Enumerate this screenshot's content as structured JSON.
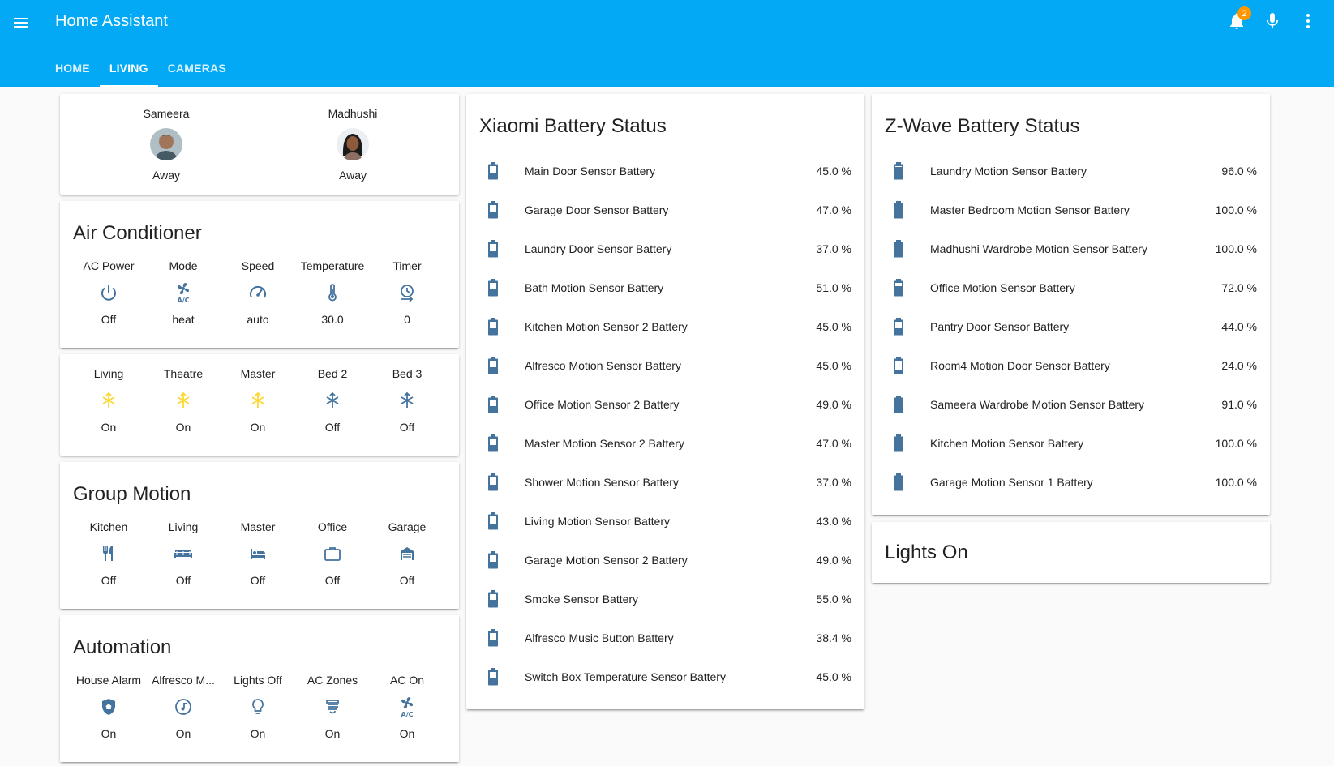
{
  "app": {
    "title": "Home Assistant",
    "notification_count": "2"
  },
  "tabs": [
    {
      "label": "HOME"
    },
    {
      "label": "LIVING"
    },
    {
      "label": "CAMERAS"
    }
  ],
  "people": [
    {
      "name": "Sameera",
      "state": "Away"
    },
    {
      "name": "Madhushi",
      "state": "Away"
    }
  ],
  "air_conditioner": {
    "title": "Air Conditioner",
    "items": [
      {
        "label": "AC Power",
        "icon": "power-icon",
        "state": "Off"
      },
      {
        "label": "Mode",
        "icon": "air-conditioner-icon",
        "state": "heat"
      },
      {
        "label": "Speed",
        "icon": "speedometer-icon",
        "state": "auto"
      },
      {
        "label": "Temperature",
        "icon": "thermometer-icon",
        "state": "30.0"
      },
      {
        "label": "Timer",
        "icon": "timer-icon",
        "state": "0"
      }
    ]
  },
  "ac_zones": {
    "items": [
      {
        "label": "Living",
        "icon": "air-zone-icon",
        "state": "On",
        "color": "#fdd835"
      },
      {
        "label": "Theatre",
        "icon": "air-zone-icon",
        "state": "On",
        "color": "#fdd835"
      },
      {
        "label": "Master",
        "icon": "air-zone-icon",
        "state": "On",
        "color": "#fdd835"
      },
      {
        "label": "Bed 2",
        "icon": "air-zone-icon",
        "state": "Off",
        "color": "#44739e"
      },
      {
        "label": "Bed 3",
        "icon": "air-zone-icon",
        "state": "Off",
        "color": "#44739e"
      }
    ]
  },
  "group_motion": {
    "title": "Group Motion",
    "items": [
      {
        "label": "Kitchen",
        "icon": "silverware-icon",
        "state": "Off"
      },
      {
        "label": "Living",
        "icon": "sofa-icon",
        "state": "Off"
      },
      {
        "label": "Master",
        "icon": "bed-icon",
        "state": "Off"
      },
      {
        "label": "Office",
        "icon": "briefcase-icon",
        "state": "Off"
      },
      {
        "label": "Garage",
        "icon": "garage-icon",
        "state": "Off"
      }
    ]
  },
  "automation": {
    "title": "Automation",
    "items": [
      {
        "label": "House Alarm",
        "icon": "shield-home-icon",
        "state": "On"
      },
      {
        "label": "Alfresco M...",
        "icon": "music-icon",
        "state": "On"
      },
      {
        "label": "Lights Off",
        "icon": "lightbulb-icon",
        "state": "On"
      },
      {
        "label": "AC Zones",
        "icon": "air-vent-icon",
        "state": "On"
      },
      {
        "label": "AC On",
        "icon": "air-conditioner-icon",
        "state": "On"
      }
    ]
  },
  "xiaomi": {
    "title": "Xiaomi Battery Status",
    "rows": [
      {
        "name": "Main Door Sensor Battery",
        "state": "45.0 %",
        "level": 45
      },
      {
        "name": "Garage Door Sensor Battery",
        "state": "47.0 %",
        "level": 47
      },
      {
        "name": "Laundry Door Sensor Battery",
        "state": "37.0 %",
        "level": 37
      },
      {
        "name": "Bath Motion Sensor Battery",
        "state": "51.0 %",
        "level": 51
      },
      {
        "name": "Kitchen Motion Sensor 2 Battery",
        "state": "45.0 %",
        "level": 45
      },
      {
        "name": "Alfresco Motion Sensor Battery",
        "state": "45.0 %",
        "level": 45
      },
      {
        "name": "Office Motion Sensor 2 Battery",
        "state": "49.0 %",
        "level": 49
      },
      {
        "name": "Master Motion Sensor 2 Battery",
        "state": "47.0 %",
        "level": 47
      },
      {
        "name": "Shower Motion Sensor Battery",
        "state": "37.0 %",
        "level": 37
      },
      {
        "name": "Living Motion Sensor Battery",
        "state": "43.0 %",
        "level": 43
      },
      {
        "name": "Garage Motion Sensor 2 Battery",
        "state": "49.0 %",
        "level": 49
      },
      {
        "name": "Smoke Sensor Battery",
        "state": "55.0 %",
        "level": 55
      },
      {
        "name": "Alfresco Music Button Battery",
        "state": "38.4 %",
        "level": 38
      },
      {
        "name": "Switch Box Temperature Sensor Battery",
        "state": "45.0 %",
        "level": 45
      }
    ]
  },
  "zwave": {
    "title": "Z-Wave Battery Status",
    "rows": [
      {
        "name": "Laundry Motion Sensor Battery",
        "state": "96.0 %",
        "level": 96
      },
      {
        "name": "Master Bedroom Motion Sensor Battery",
        "state": "100.0 %",
        "level": 100
      },
      {
        "name": "Madhushi Wardrobe Motion Sensor Battery",
        "state": "100.0 %",
        "level": 100
      },
      {
        "name": "Office Motion Sensor Battery",
        "state": "72.0 %",
        "level": 72
      },
      {
        "name": "Pantry Door Sensor Battery",
        "state": "44.0 %",
        "level": 44
      },
      {
        "name": "Room4 Motion Door Sensor Battery",
        "state": "24.0 %",
        "level": 24
      },
      {
        "name": "Sameera Wardrobe Motion Sensor Battery",
        "state": "91.0 %",
        "level": 91
      },
      {
        "name": "Kitchen Motion Sensor Battery",
        "state": "100.0 %",
        "level": 100
      },
      {
        "name": "Garage Motion Sensor 1 Battery",
        "state": "100.0 %",
        "level": 100
      }
    ]
  },
  "lights_on": {
    "title": "Lights On"
  },
  "colors": {
    "header": "#03a9f4",
    "icon": "#44739e",
    "on": "#fdd835",
    "badge": "#ff9800"
  }
}
